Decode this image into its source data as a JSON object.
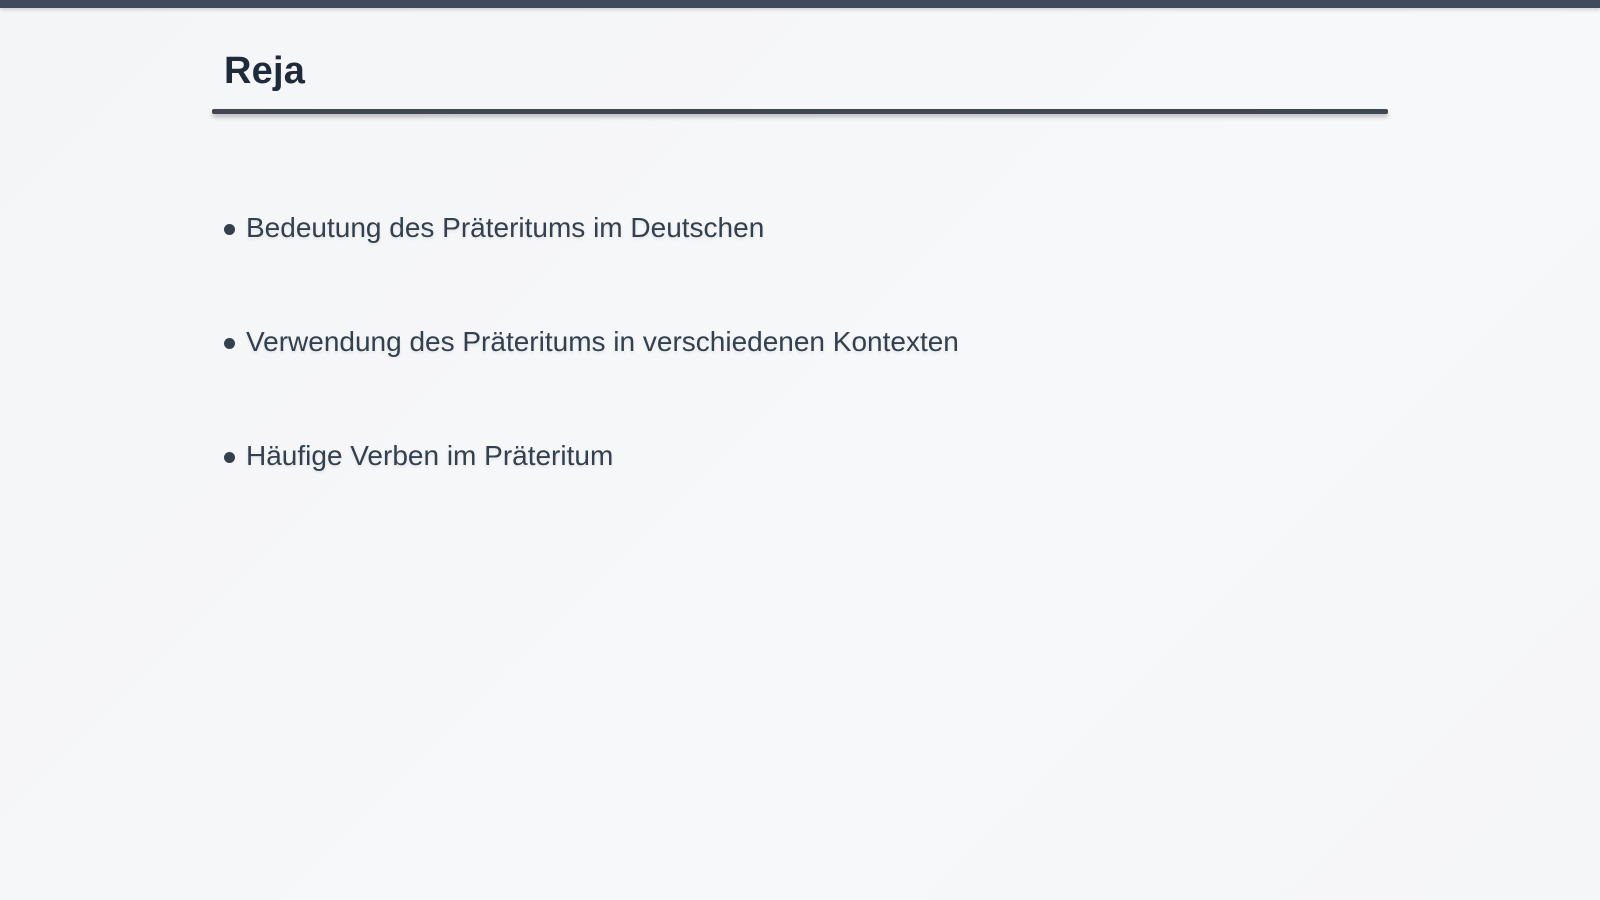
{
  "slide": {
    "title": "Reja",
    "bullets": [
      "Bedeutung des Präteritums im Deutschen",
      "Verwendung des Präteritums in verschiedenen Kontexten",
      "Häufige Verben im Präteritum"
    ]
  },
  "colors": {
    "top_bar": "#3f4a5c",
    "title_text": "#1f2a3b",
    "rule": "#3f4753",
    "bullet_text": "#33404f",
    "background": "#f5f6f8"
  }
}
